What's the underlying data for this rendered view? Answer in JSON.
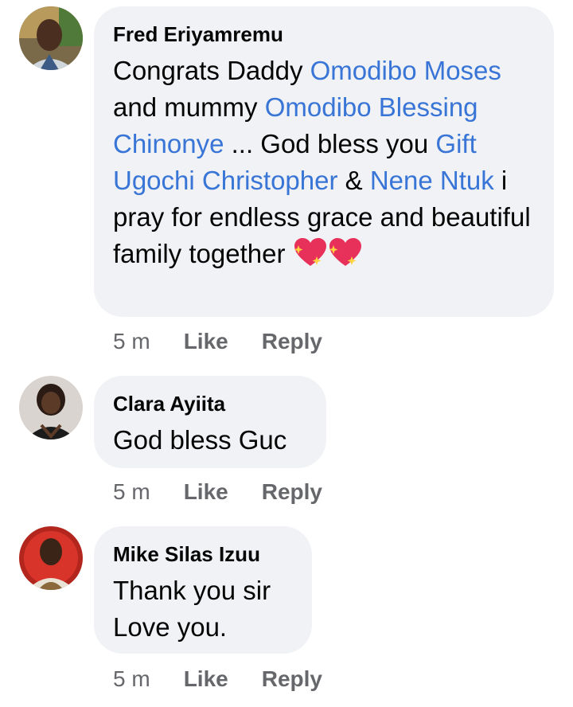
{
  "comments": [
    {
      "author": "Fred Eriyamremu",
      "segments": [
        {
          "t": "Congrats Daddy ",
          "m": false
        },
        {
          "t": "Omodibo Moses",
          "m": true
        },
        {
          "t": "  and mummy ",
          "m": false
        },
        {
          "t": "Omodibo Blessing Chinonye",
          "m": true
        },
        {
          "t": " ... God bless you ",
          "m": false
        },
        {
          "t": "Gift Ugochi Christopher",
          "m": true
        },
        {
          "t": " & ",
          "m": false
        },
        {
          "t": "Nene Ntuk",
          "m": true
        },
        {
          "t": " i pray for endless grace and beautiful family together ",
          "m": false
        }
      ],
      "emoji": [
        "sparkling-heart-icon",
        "sparkling-heart-icon"
      ],
      "time": "5 m",
      "like": "Like",
      "reply": "Reply"
    },
    {
      "author": "Clara Ayiita",
      "text": "God bless Guc",
      "time": "5 m",
      "like": "Like",
      "reply": "Reply"
    },
    {
      "author": "Mike Silas Izuu",
      "line1": "Thank you sir",
      "line2": "Love you.",
      "time": "5 m",
      "like": "Like",
      "reply": "Reply"
    }
  ],
  "colors": {
    "mention": "#3875d6",
    "bubble": "#f0f2f5",
    "meta": "#65676b"
  }
}
